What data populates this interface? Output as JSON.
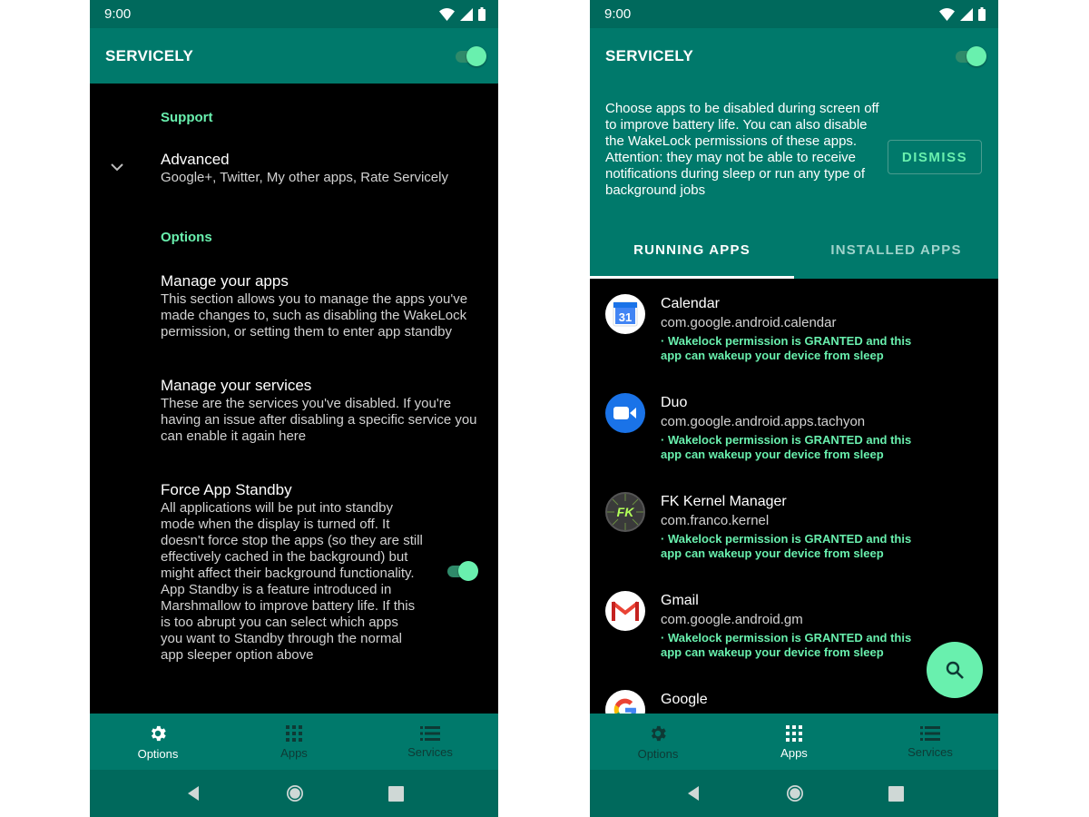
{
  "colors": {
    "primary": "#00796b",
    "primary_dark": "#00695c",
    "accent": "#69f0ae",
    "background": "#000000"
  },
  "left_screen": {
    "status_time": "9:00",
    "app_title": "SERVICELY",
    "master_switch_on": true,
    "sections": {
      "support_header": "Support",
      "advanced_title": "Advanced",
      "advanced_summary": "Google+, Twitter, My other apps, Rate Servicely",
      "options_header": "Options"
    },
    "prefs": {
      "manage_apps_title": "Manage your apps",
      "manage_apps_summary": "This section allows you to manage the apps you've made changes to, such as disabling the WakeLock permission, or setting them to enter app standby",
      "manage_services_title": "Manage your services",
      "manage_services_summary": "These are the services you've disabled. If you're having an issue after disabling a specific service you can enable it again here",
      "force_standby_title": "Force App Standby",
      "force_standby_summary": "All applications will be put into standby mode when the display is turned off. It doesn't force stop the apps (so they are still effectively cached in the background) but might affect their background functionality. App Standby is a feature introduced in Marshmallow to improve battery life. If this is too abrupt you can select which apps you want to Standby through the normal app sleeper option above",
      "force_standby_on": true
    },
    "nav": {
      "options": "Options",
      "apps": "Apps",
      "services": "Services",
      "active": "options"
    }
  },
  "right_screen": {
    "status_time": "9:00",
    "app_title": "SERVICELY",
    "master_switch_on": true,
    "banner_text": "Choose apps to be disabled during screen off to improve battery life. You can also disable the WakeLock permissions of these apps.\nAttention: they may not be able to receive notifications during sleep or run any type of background jobs",
    "dismiss_label": "DISMISS",
    "tabs": {
      "running": "RUNNING APPS",
      "installed": "INSTALLED APPS",
      "active": "running"
    },
    "apps": [
      {
        "name": "Calendar",
        "package": "com.google.android.calendar",
        "note": "· Wakelock permission is GRANTED and this app can wakeup your device from sleep",
        "icon": "calendar-icon"
      },
      {
        "name": "Duo",
        "package": "com.google.android.apps.tachyon",
        "note": "· Wakelock permission is GRANTED and this app can wakeup your device from sleep",
        "icon": "duo-icon"
      },
      {
        "name": "FK Kernel Manager",
        "package": "com.franco.kernel",
        "note": "· Wakelock permission is GRANTED and this app can wakeup your device from sleep",
        "icon": "fk-icon"
      },
      {
        "name": "Gmail",
        "package": "com.google.android.gm",
        "note": "· Wakelock permission is GRANTED and this app can wakeup your device from sleep",
        "icon": "gmail-icon"
      },
      {
        "name": "Google",
        "package": "",
        "note": "",
        "icon": "google-icon"
      }
    ],
    "calendar_icon_text": "31",
    "fk_icon_text": "FK",
    "nav": {
      "options": "Options",
      "apps": "Apps",
      "services": "Services",
      "active": "apps"
    }
  }
}
